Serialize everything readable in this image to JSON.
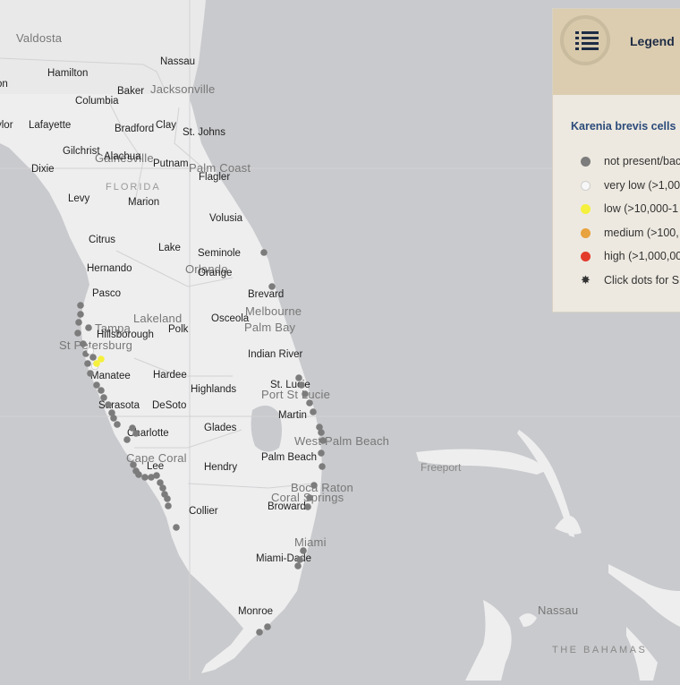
{
  "colors": {
    "water": "#c9cacd",
    "land": "#eeeeef",
    "ocean_gray": "#7c7c7c",
    "very_low": "#f7f7f7",
    "low": "#f5f03c",
    "medium": "#e8a23e",
    "high": "#e33b2b",
    "legend_header": "#dccdb0"
  },
  "legend": {
    "title": "Legend",
    "icon": "list-icon",
    "subtitle": "Karenia brevis cells",
    "items": [
      {
        "label": "not present/bac",
        "color": "#7c7c7c"
      },
      {
        "label": "very low (>1,00",
        "color": "#f7f7f7"
      },
      {
        "label": "low (>10,000-1",
        "color": "#f5f03c"
      },
      {
        "label": "medium (>100,",
        "color": "#e8a23e"
      },
      {
        "label": "high (>1,000,00",
        "color": "#e33b2b"
      }
    ],
    "note": {
      "label": "Click dots for S",
      "icon": "asterisk-icon"
    }
  },
  "map_labels": {
    "counties": [
      "Hamilton",
      "Columbia",
      "Baker",
      "Nassau",
      "Lafayette",
      "Bradford",
      "Clay",
      "St. Johns",
      "Gilchrist",
      "Alachua",
      "Putnam",
      "Dixie",
      "Flagler",
      "Levy",
      "Marion",
      "Volusia",
      "Citrus",
      "Lake",
      "Seminole",
      "Hernando",
      "Orange",
      "Pasco",
      "Brevard",
      "Osceola",
      "Polk",
      "Hillsborough",
      "Indian River",
      "Manatee",
      "Hardee",
      "Highlands",
      "St. Lucie",
      "Sarasota",
      "DeSoto",
      "Martin",
      "Charlotte",
      "Glades",
      "Lee",
      "Hendry",
      "Palm Beach",
      "Broward",
      "Collier",
      "Miami-Dade",
      "Monroe",
      "ylor",
      "on"
    ],
    "cities": [
      "Valdosta",
      "Jacksonville",
      "Gainesville",
      "Palm Coast",
      "Orlando",
      "Melbourne",
      "Palm Bay",
      "Lakeland",
      "Tampa",
      "St Petersburg",
      "Port St Lucie",
      "West Palm Beach",
      "Cape Coral",
      "Boca Raton",
      "Coral Springs",
      "Miami",
      "Nassau"
    ],
    "state": "FLORIDA",
    "islands": [
      "Freeport"
    ],
    "country": "THE BAHAMAS"
  }
}
